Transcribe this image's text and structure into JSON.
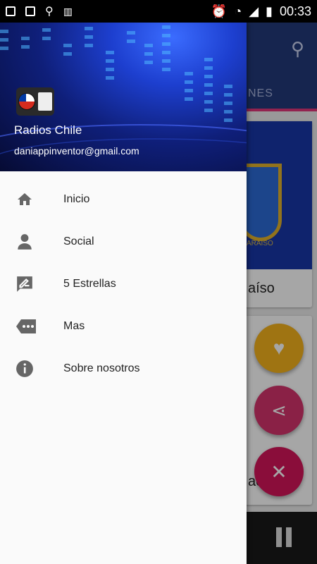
{
  "status_bar": {
    "time": "00:33"
  },
  "background": {
    "tab_partial": "NES",
    "card1_label": "aíso",
    "card2_label": "aca",
    "crest_text": "ARAISO"
  },
  "drawer": {
    "app_name": "Radios Chile",
    "email": "daniappinventor@gmail.com",
    "items": [
      {
        "label": "Inicio",
        "icon": "home-icon"
      },
      {
        "label": "Social",
        "icon": "person-icon"
      },
      {
        "label": "5 Estrellas",
        "icon": "rate-review-icon"
      },
      {
        "label": "Mas",
        "icon": "more-label-icon"
      },
      {
        "label": "Sobre nosotros",
        "icon": "info-icon"
      }
    ]
  },
  "colors": {
    "app_bar": "#233a7a",
    "tab_indicator": "#e0367a",
    "fab_heart": "#f4b21d",
    "fab_share": "#d4336c",
    "fab_close": "#d4145a"
  }
}
